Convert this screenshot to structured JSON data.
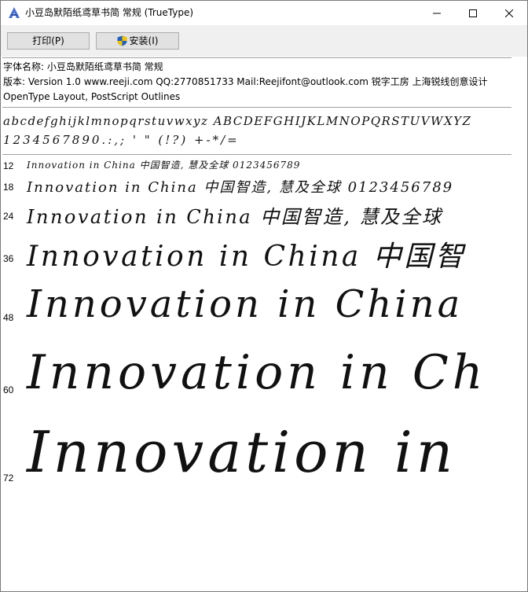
{
  "window": {
    "title": "小豆岛默陌纸鸢草书简 常规 (TrueType)"
  },
  "toolbar": {
    "print_label": "打印(P)",
    "install_label": "安装(I)"
  },
  "font_info": {
    "name_line": "字体名称: 小豆岛默陌纸鸢草书简 常规",
    "version_line": "版本: Version 1.0  www.reeji.com QQ:2770851733 Mail:Reejifont@outlook.com 锐字工房 上海锐线创意设计",
    "features_line": "OpenType Layout, PostScript Outlines"
  },
  "charset": {
    "line1": "abcdefghijklmnopqrstuvwxyz ABCDEFGHIJKLMNOPQRSTUVWXYZ",
    "line2": "1234567890.:,; ' \" (!?) +-*/="
  },
  "samples": [
    {
      "size": "12",
      "text": "Innovation in China 中国智造, 慧及全球 0123456789"
    },
    {
      "size": "18",
      "text": "Innovation in China 中国智造, 慧及全球 0123456789"
    },
    {
      "size": "24",
      "text": "Innovation in China 中国智造, 慧及全球"
    },
    {
      "size": "36",
      "text": "Innovation in China 中国智"
    },
    {
      "size": "48",
      "text": "Innovation in China"
    },
    {
      "size": "60",
      "text": "Innovation in Ch"
    },
    {
      "size": "72",
      "text": "Innovation in"
    }
  ],
  "colors": {
    "toolbar_bg": "#f0f0f0",
    "button_bg": "#e1e1e1",
    "button_border": "#adadad",
    "separator": "#a0a0a0"
  },
  "icons": {
    "app": "font-viewer-icon",
    "minimize": "minimize-icon",
    "maximize": "maximize-icon",
    "close": "close-icon",
    "install": "uac-shield-icon"
  }
}
